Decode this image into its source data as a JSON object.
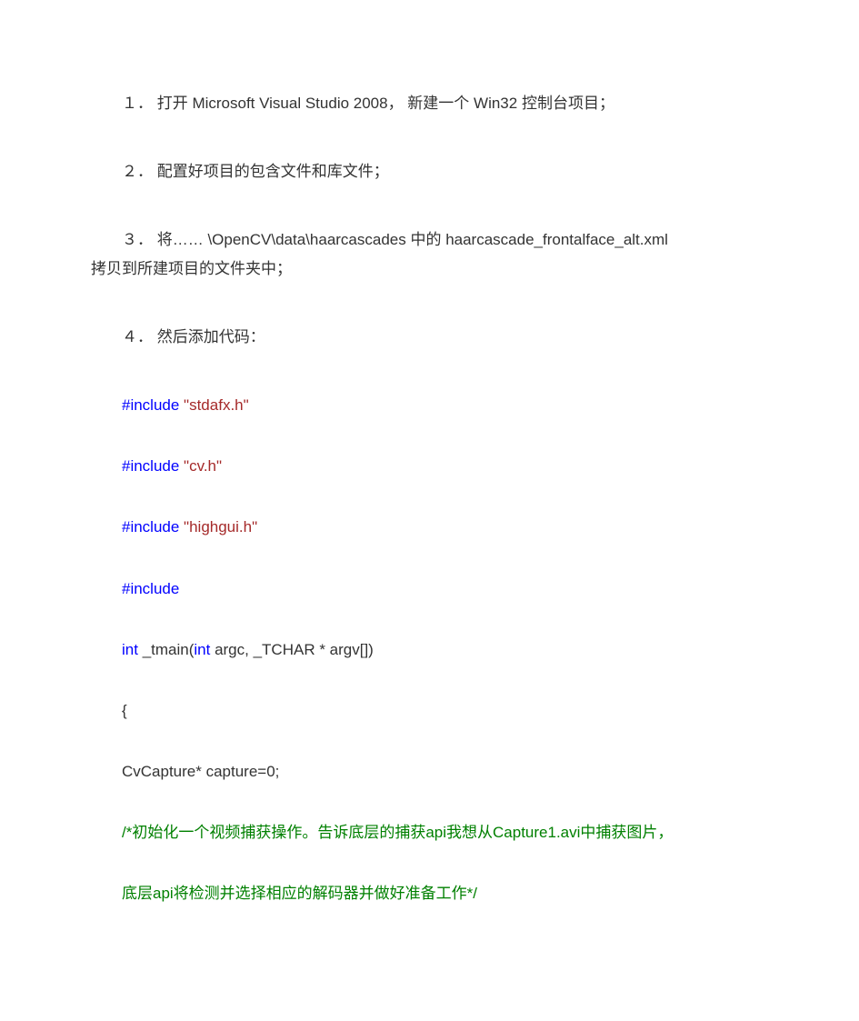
{
  "steps": {
    "s1": "１．  打开 Microsoft  Visual  Studio  2008， 新建一个 Win32 控制台项目；",
    "s2": "２．  配置好项目的包含文件和库文件；",
    "s3a": "３．  将…… \\OpenCV\\data\\haarcascades  中的  haarcascade_frontalface_alt.xml",
    "s3b": "拷贝到所建项目的文件夹中；",
    "s4": "４．  然后添加代码："
  },
  "code": {
    "inc_kw": "#include",
    "inc1_str": " \"stdafx.h\"",
    "inc2_str": " \"cv.h\"",
    "inc3_str": " \"highgui.h\"",
    "main_sig_pre": "int ",
    "main_name": "_tmain(",
    "main_args_kw1": "int",
    "main_args_mid": " argc,  _TCHAR * argv[])",
    "lbrace": "{",
    "cap_line": "CvCapture* capture=0;",
    "comment1": "/*初始化一个视频捕获操作。告诉底层的捕获api我想从Capture1.avi中捕获图片，",
    "comment2": "底层api将检测并选择相应的解码器并做好准备工作*/"
  }
}
